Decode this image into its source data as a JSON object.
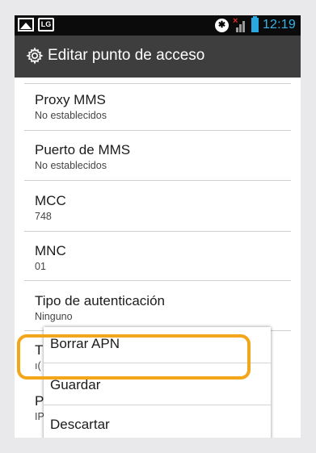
{
  "status_bar": {
    "time": "12:19",
    "icons": [
      "picture-icon",
      "lg-icon",
      "bluetooth-icon",
      "signal-icon",
      "battery-icon"
    ],
    "lg_text": "LG",
    "bluetooth_glyph": "✱",
    "no_signal_glyph": "×"
  },
  "title_bar": {
    "icon": "gear-icon",
    "title": "Editar punto de acceso"
  },
  "settings": [
    {
      "title": "Proxy MMS",
      "value": "No establecidos"
    },
    {
      "title": "Puerto de MMS",
      "value": "No establecidos"
    },
    {
      "title": "MCC",
      "value": "748"
    },
    {
      "title": "MNC",
      "value": "01"
    },
    {
      "title": "Tipo de autenticación",
      "value": "Ninguno"
    },
    {
      "title": "T",
      "value": "ı("
    },
    {
      "title": "P",
      "value": "IP"
    }
  ],
  "menu": {
    "items": [
      "Borrar APN",
      "Guardar",
      "Descartar"
    ],
    "highlighted": "Guardar"
  },
  "colors": {
    "highlight": "#f3a61a",
    "status_time": "#36b4ea",
    "title_bar": "#3e3e3e"
  }
}
